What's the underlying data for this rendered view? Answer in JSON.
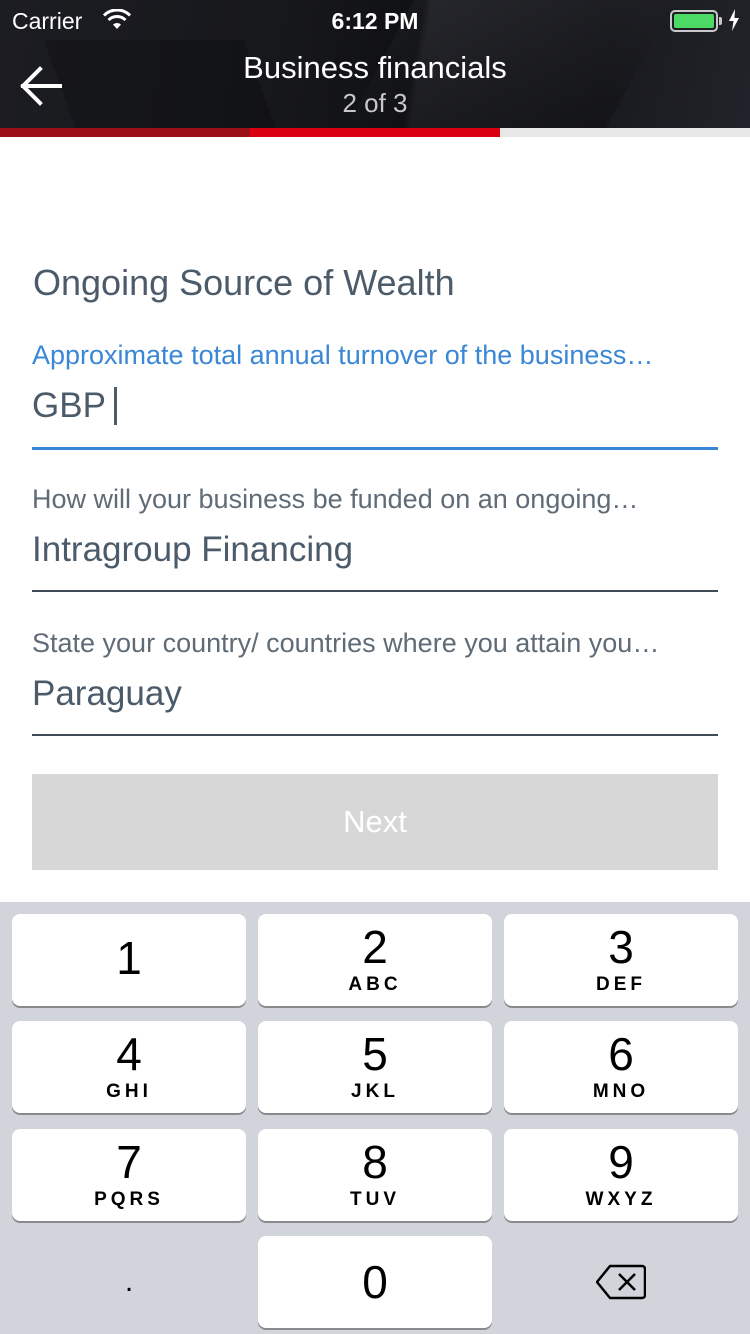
{
  "status_bar": {
    "carrier": "Carrier",
    "time": "6:12 PM"
  },
  "nav": {
    "title": "Business financials",
    "subtitle": "2 of 3"
  },
  "progress": {
    "current_step": 2,
    "total_steps": 3,
    "colors": {
      "done": "#9b1018",
      "current": "#db0011",
      "remaining": "#e7e7e7"
    }
  },
  "form": {
    "section_title": "Ongoing Source of Wealth",
    "fields": [
      {
        "label": "Approximate total annual turnover of the business…",
        "value": "GBP"
      },
      {
        "label": "How will your business be funded on an ongoing…",
        "value": "Intragroup Financing"
      },
      {
        "label": "State your country/ countries where you attain you…",
        "value": "Paraguay"
      }
    ],
    "next_label": "Next"
  },
  "keyboard": {
    "keys": [
      {
        "num": "1",
        "letters": ""
      },
      {
        "num": "2",
        "letters": "ABC"
      },
      {
        "num": "3",
        "letters": "DEF"
      },
      {
        "num": "4",
        "letters": "GHI"
      },
      {
        "num": "5",
        "letters": "JKL"
      },
      {
        "num": "6",
        "letters": "MNO"
      },
      {
        "num": "7",
        "letters": "PQRS"
      },
      {
        "num": "8",
        "letters": "TUV"
      },
      {
        "num": "9",
        "letters": "WXYZ"
      },
      {
        "num": ".",
        "letters": ""
      },
      {
        "num": "0",
        "letters": ""
      }
    ]
  },
  "colors": {
    "accent": "#3a87d6",
    "brand_red": "#db0011",
    "text": "#4c5b6a",
    "button_disabled": "#d7d7d7"
  }
}
